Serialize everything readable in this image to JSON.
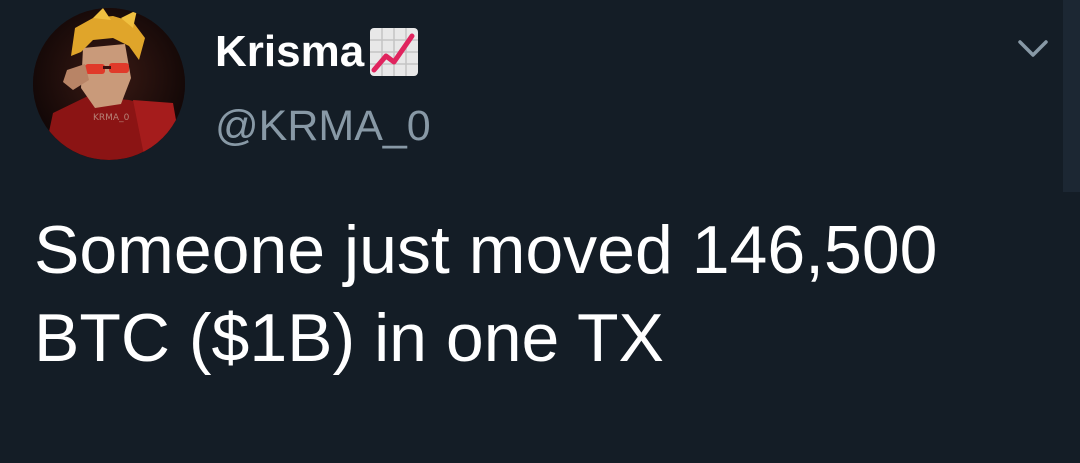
{
  "tweet": {
    "display_name": "Krisma",
    "name_emoji": "chart-increasing-emoji",
    "handle": "@KRMA_0",
    "avatar_watermark": "KRMA_0",
    "text": "Someone just moved 146,500 BTC ($1B) in one TX"
  },
  "icons": {
    "menu_caret": "chevron-down-icon",
    "avatar": "avatar"
  },
  "colors": {
    "background": "#141d26",
    "text_primary": "#ffffff",
    "text_secondary": "#8899a6",
    "emoji_chart_line": "#e0245e"
  }
}
